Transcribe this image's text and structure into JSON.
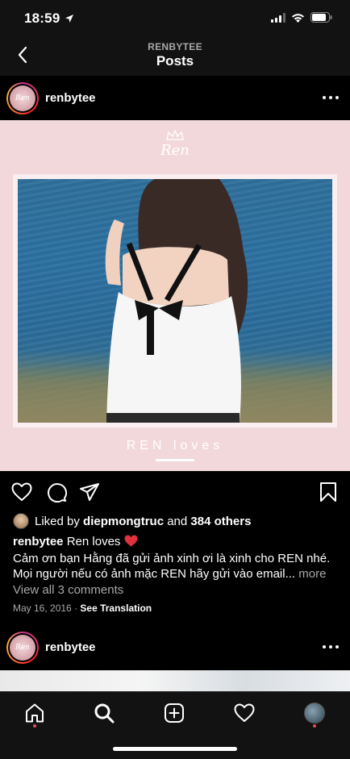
{
  "status_bar": {
    "time": "18:59"
  },
  "nav": {
    "subtitle": "RENBYTEE",
    "title": "Posts"
  },
  "post1": {
    "username": "renbytee",
    "image": {
      "logo_text": "Ren",
      "avatar_text": "Ren",
      "caption_overlay": "REN loves"
    },
    "liked_by_prefix": "Liked by",
    "liked_by_user": "diepmongtruc",
    "liked_by_and": "and",
    "liked_by_others": "384 others",
    "caption_username": "renbytee",
    "caption_title": "Ren loves",
    "caption_body": "Cảm ơn bạn Hằng đã gửi ảnh xinh ơi là xinh cho REN nhé. Mọi người nếu có ảnh mặc REN hãy gửi vào email...",
    "caption_more": "more",
    "view_comments": "View all 3 comments",
    "date": "May 16, 2016",
    "separator": "·",
    "see_translation": "See Translation"
  },
  "post2": {
    "username": "renbytee",
    "avatar_text": "Ren"
  },
  "colors": {
    "background": "#000000",
    "bar": "#121212",
    "image_bg": "#f2d8da",
    "secondary_text": "#a8a8a8",
    "notification_dot": "#ed4956"
  },
  "tabs": [
    "home-icon",
    "search-icon",
    "new-post-icon",
    "activity-icon",
    "profile-tab"
  ]
}
